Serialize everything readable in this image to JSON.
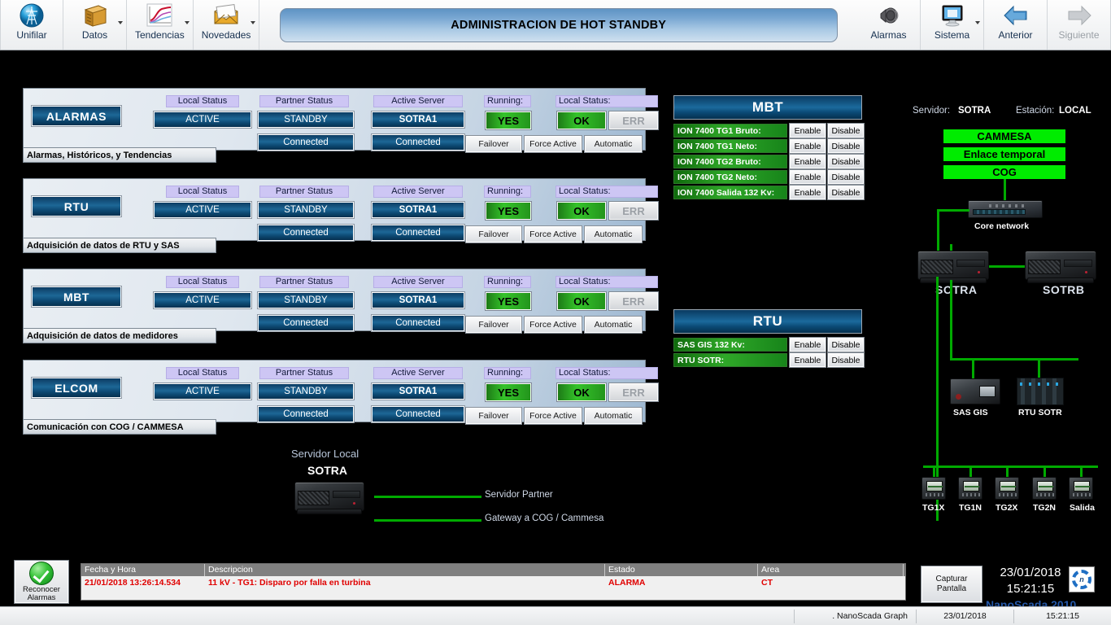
{
  "ribbon": {
    "groups": [
      {
        "label": "Unifilar",
        "icon": "tower-icon",
        "caret": false,
        "disabled": false
      },
      {
        "label": "Datos",
        "icon": "database-icon",
        "caret": true,
        "disabled": false
      },
      {
        "label": "Tendencias",
        "icon": "trend-chart-icon",
        "caret": true,
        "disabled": false
      },
      {
        "label": "Novedades",
        "icon": "envelope-icon",
        "caret": true,
        "disabled": false
      }
    ],
    "right_groups": [
      {
        "label": "Alarmas",
        "icon": "bell-icon",
        "caret": false,
        "disabled": false
      },
      {
        "label": "Sistema",
        "icon": "monitor-icon",
        "caret": true,
        "disabled": false
      },
      {
        "label": "Anterior",
        "icon": "arrow-left-icon",
        "caret": false,
        "disabled": false
      },
      {
        "label": "Siguiente",
        "icon": "arrow-right-icon",
        "caret": false,
        "disabled": true
      }
    ],
    "title": "ADMINISTRACION DE HOT STANDBY"
  },
  "column_headers": {
    "local_status": "Local Status",
    "partner_status": "Partner Status",
    "active_server": "Active Server",
    "running": "Running:",
    "local_status_2": "Local Status:"
  },
  "actions": {
    "failover": "Failover",
    "force_active": "Force Active",
    "automatic": "Automatic"
  },
  "services": [
    {
      "name": "ALARMAS",
      "subtitle": "Alarmas, Históricos, y Tendencias",
      "local_status": "ACTIVE",
      "partner_status": "STANDBY",
      "partner_conn": "Connected",
      "active_server": "SOTRA1",
      "active_conn": "Connected",
      "running": "YES",
      "ok": "OK",
      "err": "ERR"
    },
    {
      "name": "RTU",
      "subtitle": "Adquisición de datos de RTU y SAS",
      "local_status": "ACTIVE",
      "partner_status": "STANDBY",
      "partner_conn": "Connected",
      "active_server": "SOTRA1",
      "active_conn": "Connected",
      "running": "YES",
      "ok": "OK",
      "err": "ERR"
    },
    {
      "name": "MBT",
      "subtitle": "Adquisición de datos de medidores",
      "local_status": "ACTIVE",
      "partner_status": "STANDBY",
      "partner_conn": "Connected",
      "active_server": "SOTRA1",
      "active_conn": "Connected",
      "running": "YES",
      "ok": "OK",
      "err": "ERR"
    },
    {
      "name": "ELCOM",
      "subtitle": "Comunicación con COG / CAMMESA",
      "local_status": "ACTIVE",
      "partner_status": "STANDBY",
      "partner_conn": "Connected",
      "active_server": "SOTRA1",
      "active_conn": "Connected",
      "running": "YES",
      "ok": "OK",
      "err": "ERR"
    }
  ],
  "mbt_panel": {
    "title": "MBT",
    "enable_label": "Enable",
    "disable_label": "Disable",
    "rows": [
      {
        "name": "ION 7400 TG1 Bruto:"
      },
      {
        "name": "ION 7400 TG1 Neto:"
      },
      {
        "name": "ION 7400 TG2 Bruto:"
      },
      {
        "name": "ION 7400 TG2 Neto:"
      },
      {
        "name": "ION 7400 Salida 132 Kv:"
      }
    ]
  },
  "rtu_panel": {
    "title": "RTU",
    "enable_label": "Enable",
    "disable_label": "Disable",
    "rows": [
      {
        "name": "SAS GIS 132 Kv:"
      },
      {
        "name": "RTU SOTR:"
      }
    ]
  },
  "local_server_diagram": {
    "title": "Servidor Local",
    "server_name": "SOTRA",
    "link_partner": "Servidor Partner",
    "link_gateway": "Gateway a COG / Cammesa"
  },
  "network": {
    "servidor_label": "Servidor:",
    "servidor_value": "SOTRA",
    "estacion_label": "Estación:",
    "estacion_value": "LOCAL",
    "bars": [
      "CAMMESA",
      "Enlace temporal",
      "COG"
    ],
    "core_network": "Core network",
    "server_a": "SOTRA",
    "server_b": "SOTRB",
    "sas_gis": "SAS GIS",
    "rtu_sotr": "RTU SOTR",
    "meters": [
      "TG1X",
      "TG1N",
      "TG2X",
      "TG2N",
      "Salida"
    ]
  },
  "alarm_bar": {
    "ack_line1": "Reconocer",
    "ack_line2": "Alarmas",
    "headers": [
      "Fecha y Hora",
      "Descripcion",
      "Estado",
      "Area"
    ],
    "rows": [
      {
        "datetime": "21/01/2018 13:26:14.534",
        "description": "11 kV - TG1: Disparo por falla en turbina",
        "estado": "ALARMA",
        "area": "CT"
      }
    ],
    "capture_line1": "Capturar",
    "capture_line2": "Pantalla",
    "date": "23/01/2018",
    "time": "15:21:15",
    "brand": "NanoScada  2010"
  },
  "status_bar": {
    "app": ".  NanoScada Graph",
    "date": "23/01/2018",
    "time": "15:21:15"
  },
  "colors": {
    "green": "#00ec00",
    "alarm_red": "#e00000",
    "panel_blue": "#1d6796",
    "accent_violet": "#cdc6f4"
  }
}
